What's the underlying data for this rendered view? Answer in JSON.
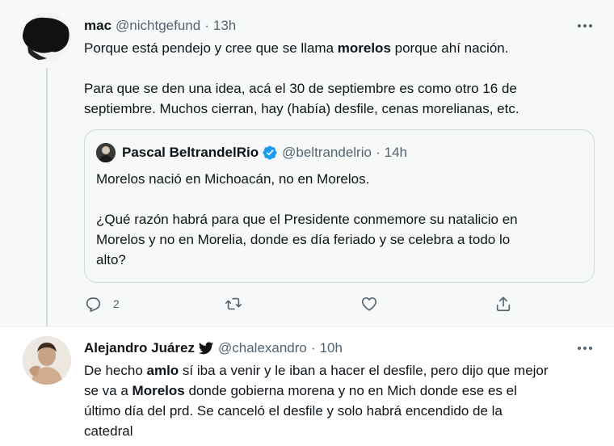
{
  "tweets": [
    {
      "name": "mac",
      "handle": "@nichtgefund",
      "separator": "·",
      "time": "13h",
      "para1_parts": [
        "Porque está pendejo y cree que se llama ",
        "morelos",
        " porque ahí nación."
      ],
      "para2_line1": "Para que se den una idea, acá el 30 de septiembre es como otro 16 de",
      "para2_line2": "septiembre. Muchos cierran, hay (había) desfile, cenas morelianas, etc.",
      "quote": {
        "name": "Pascal BeltrandelRio",
        "handle": "@beltrandelrio",
        "separator": "·",
        "time": "14h",
        "para1": "Morelos nació en Michoacán, no en Morelos.",
        "para2_line1": "¿Qué razón habrá para que el Presidente conmemore su natalicio en",
        "para2_line2": "Morelos y no en Morelia, donde es día feriado y se celebra a todo lo",
        "para2_line3": "alto?"
      },
      "actions": {
        "reply_count": "2",
        "reply_icon": "reply-icon",
        "retweet_icon": "retweet-icon",
        "like_icon": "heart-icon",
        "share_icon": "share-icon"
      }
    },
    {
      "name": "Alejandro Juárez",
      "handle": "@chalexandro",
      "separator": "·",
      "time": "10h",
      "line1_parts": [
        "De hecho ",
        "amlo",
        " sí iba a venir y le iban a hacer el desfile, pero dijo que mejor"
      ],
      "line2_parts": [
        "se va a ",
        "Morelos",
        " donde gobierna morena y no en Mich donde ese es el"
      ],
      "line3": "último día del prd. Se canceló el desfile y solo habrá encendido de la",
      "line4": "catedral"
    }
  ],
  "colors": {
    "text": "#0f1419",
    "secondary": "#536471",
    "border": "#cfd9de",
    "highlight_bg": "#f7f9f9",
    "verified": "#1d9bf0"
  }
}
